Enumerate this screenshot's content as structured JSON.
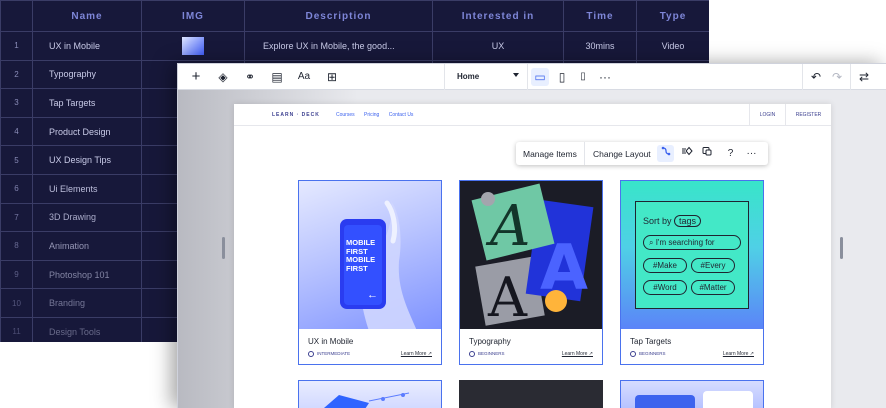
{
  "sheet": {
    "columns": [
      "",
      "Name",
      "IMG",
      "Description",
      "Interested in",
      "Time",
      "Type"
    ],
    "rows": [
      {
        "num": "1",
        "name": "UX in Mobile",
        "desc": "Explore UX in Mobile, the good...",
        "interest": "UX",
        "time": "30mins",
        "type": "Video"
      },
      {
        "num": "2",
        "name": "Typography",
        "desc": "",
        "interest": "",
        "time": "",
        "type": ""
      },
      {
        "num": "3",
        "name": "Tap Targets",
        "desc": "",
        "interest": "",
        "time": "",
        "type": ""
      },
      {
        "num": "4",
        "name": "Product Design",
        "desc": "",
        "interest": "",
        "time": "",
        "type": ""
      },
      {
        "num": "5",
        "name": "UX Design Tips",
        "desc": "",
        "interest": "",
        "time": "",
        "type": ""
      },
      {
        "num": "6",
        "name": "Ui Elements",
        "desc": "",
        "interest": "",
        "time": "",
        "type": ""
      },
      {
        "num": "7",
        "name": "3D Drawing",
        "desc": "",
        "interest": "",
        "time": "",
        "type": ""
      },
      {
        "num": "8",
        "name": "Animation",
        "desc": "",
        "interest": "",
        "time": "",
        "type": ""
      },
      {
        "num": "9",
        "name": "Photoshop 101",
        "desc": "",
        "interest": "",
        "time": "",
        "type": ""
      },
      {
        "num": "10",
        "name": "Branding",
        "desc": "",
        "interest": "",
        "time": "",
        "type": ""
      },
      {
        "num": "11",
        "name": "Design Tools",
        "desc": "",
        "interest": "",
        "time": "",
        "type": ""
      }
    ]
  },
  "toolbar": {
    "add": "+",
    "layers": "◈",
    "connect": "⚭",
    "pages": "▤",
    "fonts": "Aa",
    "apps": "⊞",
    "page_name": "Home",
    "desktop": "▭",
    "tablet": "▯",
    "mobile": "▯",
    "more": "···",
    "undo": "↶",
    "redo": "↷",
    "swap": "⇄"
  },
  "site": {
    "logo": "LEARN · DECK",
    "nav": [
      "Courses",
      "Pricing",
      "Contact Us"
    ],
    "login": "LOGIN",
    "register": "REGISTER"
  },
  "float_bar": {
    "manage": "Manage Items",
    "layout": "Change Layout",
    "help": "?",
    "more": "···"
  },
  "cards": [
    {
      "title": "UX in Mobile",
      "level": "INTERMEDIATE",
      "more": "Learn More ↗",
      "phone_text": "MOBILE FIRST MOBILE FIRST"
    },
    {
      "title": "Typography",
      "level": "BEGINNERS",
      "more": "Learn More ↗"
    },
    {
      "title": "Tap Targets",
      "level": "BEGINNERS",
      "more": "Learn More ↗",
      "tags": {
        "sort_by": "Sort by",
        "tag_word": "tags",
        "searching": "I'm searching for",
        "t1": "#Make",
        "t2": "#Every",
        "t3": "#Word",
        "t4": "#Matter"
      }
    }
  ],
  "colors": {
    "accent": "#3d63ee",
    "sheet_bg": "#17183a",
    "header_text": "#7e86d8"
  }
}
